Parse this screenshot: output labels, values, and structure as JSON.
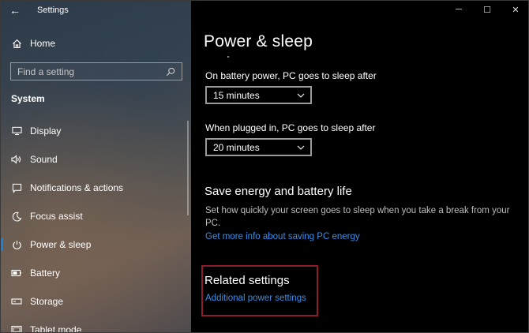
{
  "window": {
    "app_title": "Settings",
    "back_icon": "←",
    "controls": {
      "minimize": "─",
      "maximize": "☐",
      "close": "✕"
    }
  },
  "sidebar": {
    "home_label": "Home",
    "search": {
      "placeholder": "Find a setting",
      "value": ""
    },
    "section_heading": "System",
    "items": [
      {
        "label": "Display",
        "icon": "display-icon",
        "active": false
      },
      {
        "label": "Sound",
        "icon": "sound-icon",
        "active": false
      },
      {
        "label": "Notifications & actions",
        "icon": "notifications-icon",
        "active": false
      },
      {
        "label": "Focus assist",
        "icon": "moon-icon",
        "active": false
      },
      {
        "label": "Power & sleep",
        "icon": "power-icon",
        "active": true
      },
      {
        "label": "Battery",
        "icon": "battery-icon",
        "active": false
      },
      {
        "label": "Storage",
        "icon": "storage-icon",
        "active": false
      },
      {
        "label": "Tablet mode",
        "icon": "tablet-icon",
        "active": false
      }
    ]
  },
  "main": {
    "title": "Power & sleep",
    "battery_sleep": {
      "label": "On battery power, PC goes to sleep after",
      "value": "15 minutes"
    },
    "plugged_sleep": {
      "label": "When plugged in, PC goes to sleep after",
      "value": "20 minutes"
    },
    "save_energy": {
      "heading": "Save energy and battery life",
      "description": "Set how quickly your screen goes to sleep when you take a break from your PC.",
      "link": "Get more info about saving PC energy"
    },
    "related": {
      "heading": "Related settings",
      "link": "Additional power settings"
    }
  },
  "colors": {
    "accent": "#1e7fd8",
    "link": "#3a8ee6",
    "highlight_border": "#8c1d2e"
  }
}
